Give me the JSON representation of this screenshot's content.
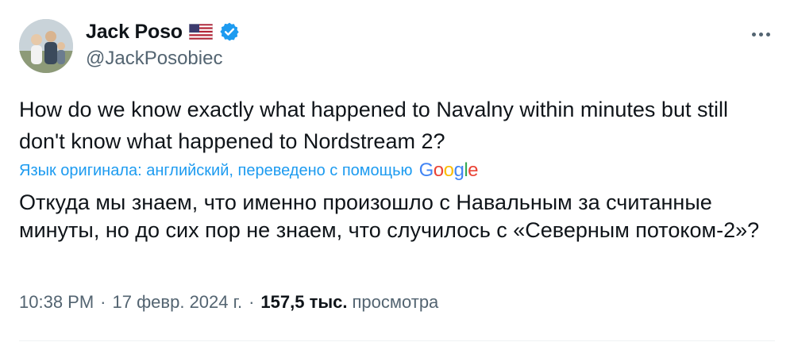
{
  "author": {
    "display_name": "Jack Poso",
    "handle": "@JackPosobiec",
    "flag_icon": "us-flag-icon",
    "verified_icon": "verified-badge-icon",
    "verified_color": "#1d9bf0"
  },
  "more_icon": "more-dots-icon",
  "tweet": {
    "original_text": "How do we know exactly what happened to Navalny within minutes but still don't know what happened to Nordstream 2?",
    "translation_note": "Язык оригинала: английский, переведено с помощью",
    "translation_provider": "Google",
    "translated_text": "Откуда мы знаем, что именно произошло с Навальным за считанные минуты, но до сих пор не знаем, что случилось с «Северным потоком-2»?"
  },
  "meta": {
    "time": "10:38 PM",
    "separator": "·",
    "date": "17 февр. 2024 г.",
    "views_count": "157,5 тыс.",
    "views_label": "просмотра"
  },
  "colors": {
    "text": "#0f1419",
    "secondary": "#536471",
    "link": "#1d9bf0"
  }
}
